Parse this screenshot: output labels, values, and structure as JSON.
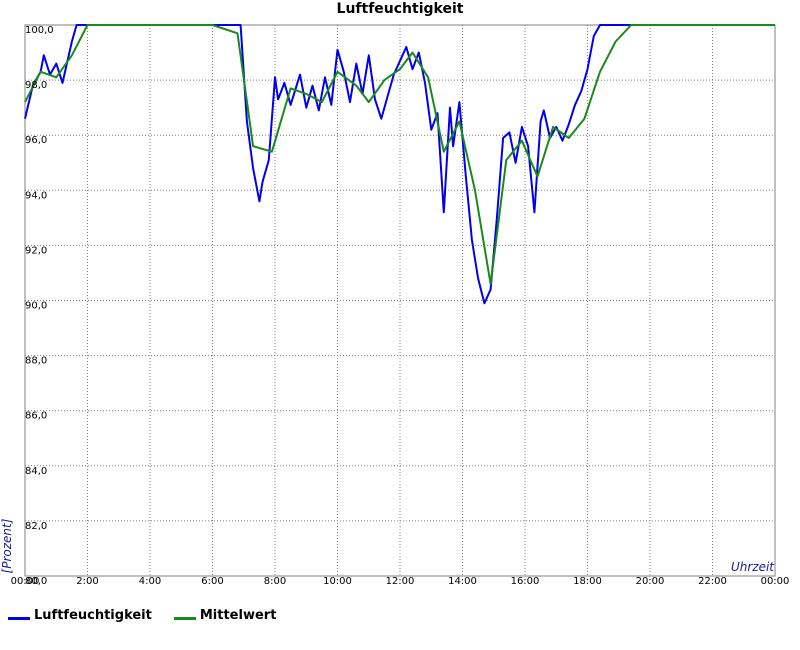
{
  "chart_data": {
    "type": "line",
    "title": "Luftfeuchtigkeit",
    "xlabel": "Uhrzeit",
    "ylabel": "[Prozent]",
    "xlim": [
      0,
      24
    ],
    "ylim": [
      80,
      100
    ],
    "x_ticks": [
      "00:00",
      "2:00",
      "4:00",
      "6:00",
      "8:00",
      "10:00",
      "12:00",
      "14:00",
      "16:00",
      "18:00",
      "20:00",
      "22:00",
      "00:00"
    ],
    "y_ticks": [
      "80,0",
      "82,0",
      "84,0",
      "86,0",
      "88,0",
      "90,0",
      "92,0",
      "94,0",
      "96,0",
      "98,0",
      "100,0"
    ],
    "grid": true,
    "legend_position": "bottom-left",
    "series": [
      {
        "name": "Luftfeuchtigkeit",
        "color": "#0000ee",
        "x": [
          0.0,
          0.25,
          0.5,
          0.6,
          0.8,
          1.0,
          1.2,
          1.5,
          1.65,
          2.0,
          4.0,
          6.0,
          6.9,
          7.1,
          7.3,
          7.5,
          7.6,
          7.8,
          8.0,
          8.1,
          8.3,
          8.5,
          8.8,
          9.0,
          9.2,
          9.4,
          9.6,
          9.8,
          10.0,
          10.2,
          10.4,
          10.6,
          10.8,
          11.0,
          11.2,
          11.4,
          11.6,
          11.8,
          12.0,
          12.2,
          12.4,
          12.6,
          12.8,
          13.0,
          13.2,
          13.4,
          13.6,
          13.7,
          13.9,
          14.1,
          14.3,
          14.5,
          14.7,
          14.9,
          15.1,
          15.3,
          15.5,
          15.7,
          15.9,
          16.1,
          16.3,
          16.5,
          16.6,
          16.8,
          17.0,
          17.2,
          17.4,
          17.6,
          17.8,
          18.0,
          18.2,
          18.4,
          18.7,
          19.0,
          20.0,
          22.0,
          24.0
        ],
        "values": [
          96.6,
          97.8,
          98.3,
          98.9,
          98.2,
          98.6,
          97.9,
          99.4,
          100.0,
          100.0,
          100.0,
          100.0,
          100.0,
          96.5,
          94.8,
          93.6,
          94.3,
          95.1,
          98.1,
          97.3,
          97.9,
          97.1,
          98.2,
          97.0,
          97.8,
          96.9,
          98.1,
          97.1,
          99.1,
          98.3,
          97.2,
          98.6,
          97.5,
          98.9,
          97.3,
          96.6,
          97.4,
          98.2,
          98.7,
          99.2,
          98.4,
          99.0,
          97.9,
          96.2,
          96.8,
          93.2,
          97.0,
          95.6,
          97.2,
          94.6,
          92.2,
          90.8,
          89.9,
          90.4,
          93.0,
          95.9,
          96.1,
          95.0,
          96.3,
          95.6,
          93.2,
          96.5,
          96.9,
          95.9,
          96.3,
          95.8,
          96.4,
          97.1,
          97.6,
          98.4,
          99.6,
          100.0,
          100.0,
          100.0,
          100.0,
          100.0,
          100.0
        ]
      },
      {
        "name": "Mittelwert",
        "color": "#1a8a1a",
        "x": [
          0.0,
          0.5,
          1.0,
          1.5,
          2.0,
          4.0,
          6.0,
          6.8,
          7.3,
          7.9,
          8.5,
          9.0,
          9.5,
          10.0,
          10.6,
          11.0,
          11.5,
          12.0,
          12.4,
          12.9,
          13.4,
          13.9,
          14.4,
          14.9,
          15.4,
          15.9,
          16.4,
          16.9,
          17.4,
          17.9,
          18.4,
          18.9,
          19.4,
          20.0,
          22.0,
          24.0
        ],
        "values": [
          97.2,
          98.3,
          98.1,
          98.9,
          100.0,
          100.0,
          100.0,
          99.7,
          95.6,
          95.4,
          97.7,
          97.5,
          97.2,
          98.3,
          97.8,
          97.2,
          98.0,
          98.4,
          99.0,
          98.1,
          95.4,
          96.5,
          94.0,
          90.6,
          95.1,
          95.8,
          94.5,
          96.3,
          95.9,
          96.6,
          98.3,
          99.4,
          100.0,
          100.0,
          100.0,
          100.0
        ]
      }
    ]
  }
}
